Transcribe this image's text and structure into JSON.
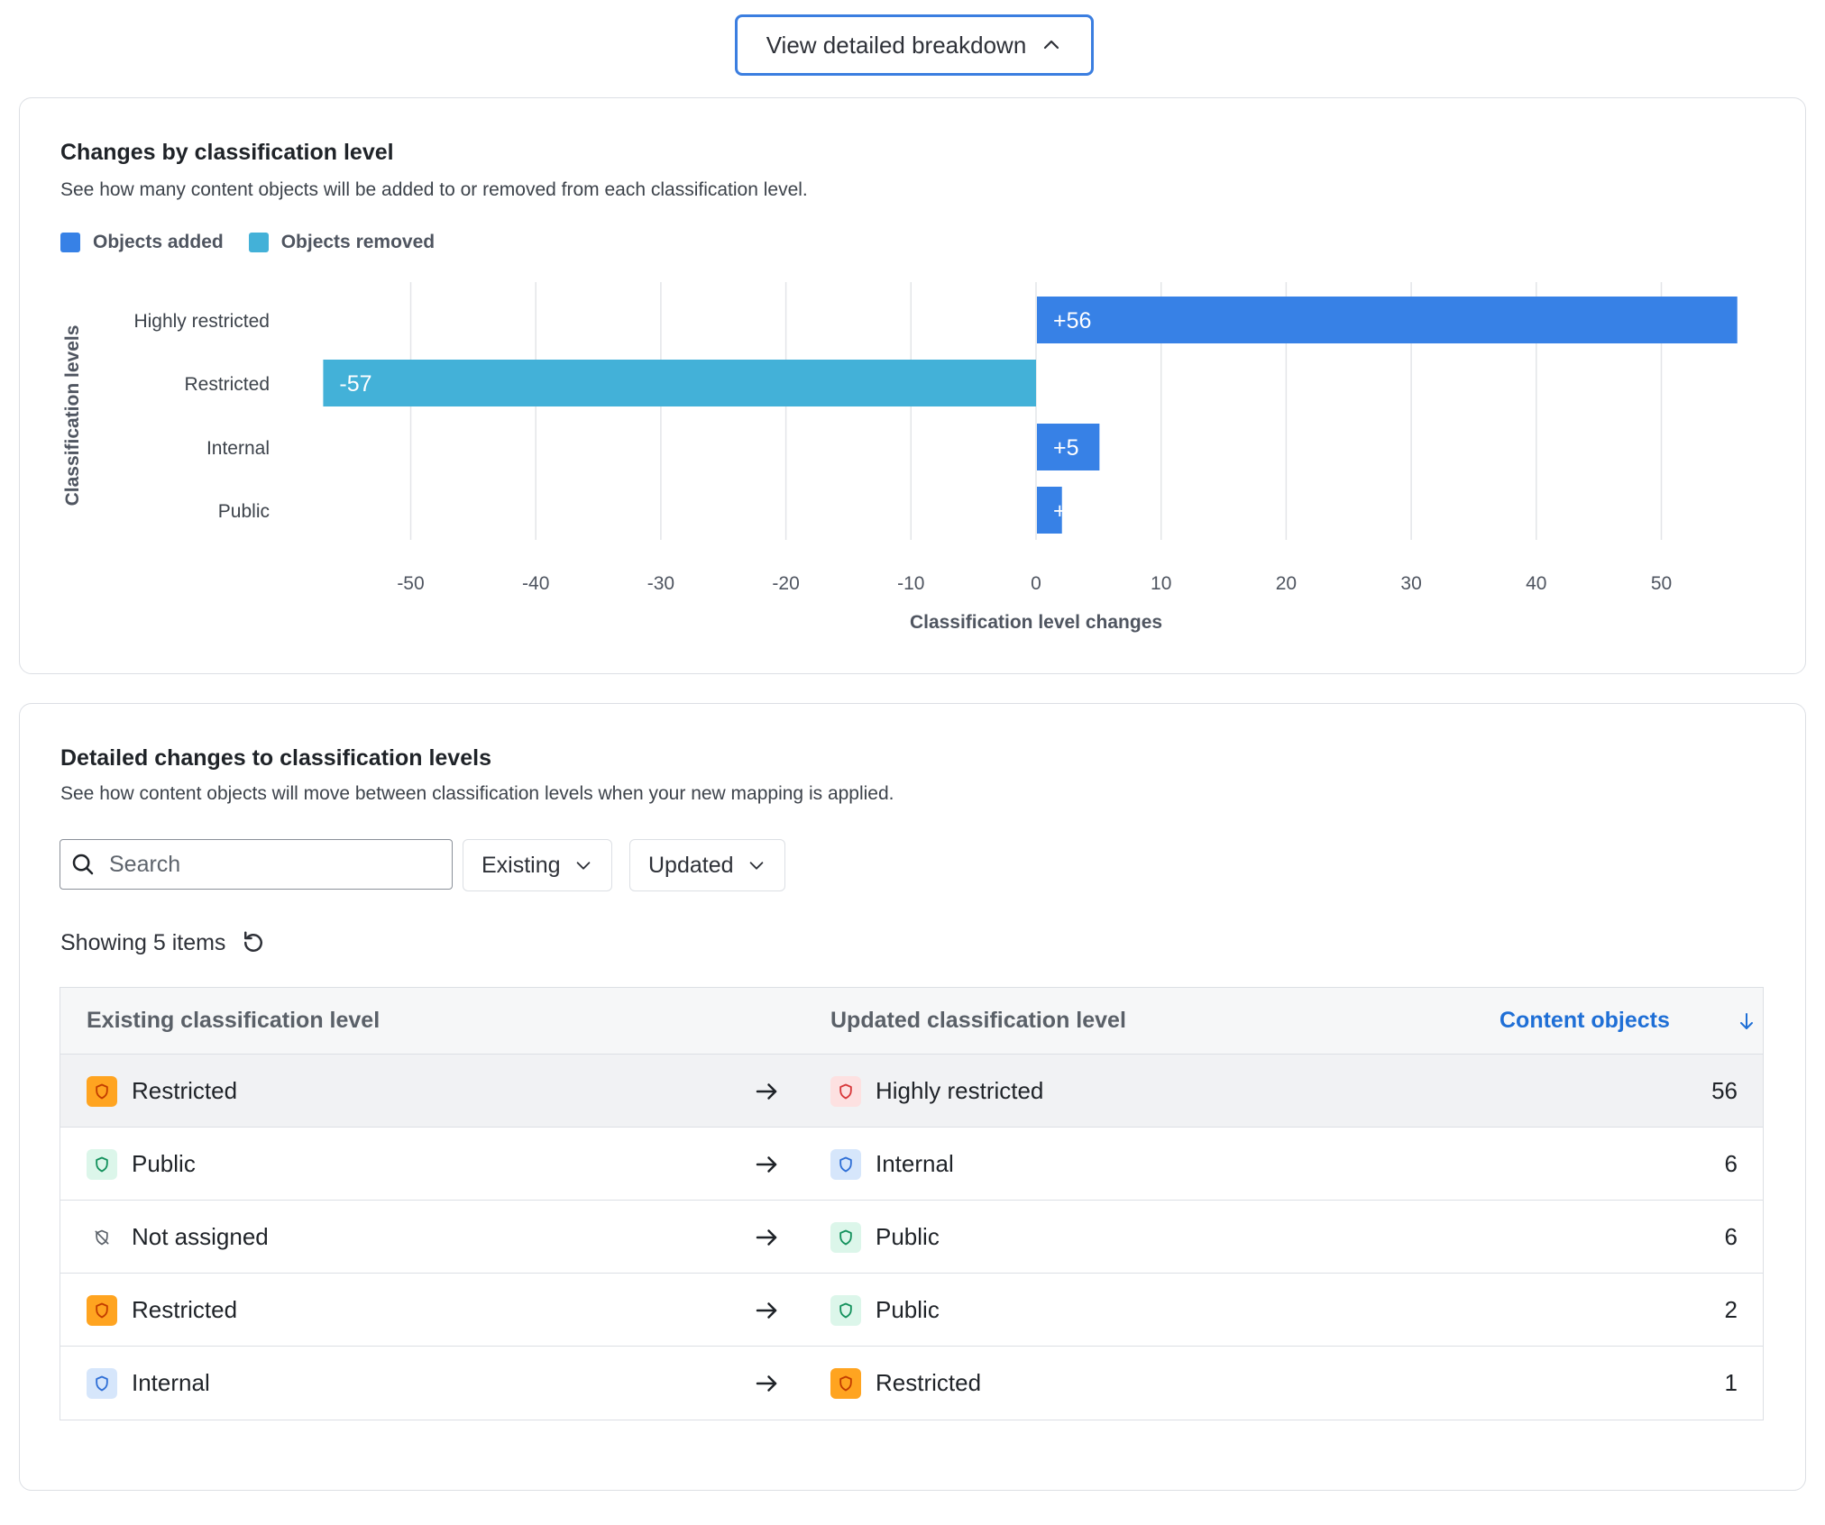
{
  "toggle": {
    "label": "View detailed breakdown",
    "icon": "chevron-up-icon"
  },
  "chart_card": {
    "title": "Changes by classification level",
    "subtitle": "See how many content objects will be added to or removed from each classification level.",
    "legend": [
      {
        "label": "Objects added",
        "color": "#3781e6"
      },
      {
        "label": "Objects removed",
        "color": "#43b1d8"
      }
    ]
  },
  "chart_data": {
    "type": "bar",
    "orientation": "horizontal",
    "categories": [
      "Highly restricted",
      "Restricted",
      "Internal",
      "Public"
    ],
    "values": [
      56,
      -57,
      5,
      2
    ],
    "data_labels": [
      "+56",
      "-57",
      "+5",
      "+"
    ],
    "series": [
      {
        "name": "Objects added",
        "color": "#3781e6"
      },
      {
        "name": "Objects removed",
        "color": "#43b1d8"
      }
    ],
    "xlabel": "Classification level changes",
    "ylabel": "Classification levels",
    "xlim": [
      -57,
      57
    ],
    "xticks": [
      -50,
      -40,
      -30,
      -20,
      -10,
      0,
      10,
      20,
      30,
      40,
      50
    ],
    "grid": "vertical",
    "legend": "top-left"
  },
  "table_card": {
    "title": "Detailed changes to classification levels",
    "subtitle": "See how content objects will move between classification levels when your new mapping is applied.",
    "search": {
      "placeholder": "Search",
      "value": ""
    },
    "filters": {
      "existing": "Existing",
      "updated": "Updated"
    },
    "showing": "Showing 5 items",
    "columns": {
      "existing": "Existing classification level",
      "updated": "Updated classification level",
      "content": "Content objects"
    },
    "rows": [
      {
        "existing": "Restricted",
        "existing_level": "restricted",
        "updated": "Highly restricted",
        "updated_level": "highly",
        "count": "56"
      },
      {
        "existing": "Public",
        "existing_level": "public",
        "updated": "Internal",
        "updated_level": "internal",
        "count": "6"
      },
      {
        "existing": "Not assigned",
        "existing_level": "none",
        "updated": "Public",
        "updated_level": "public",
        "count": "6"
      },
      {
        "existing": "Restricted",
        "existing_level": "restricted",
        "updated": "Public",
        "updated_level": "public",
        "count": "2"
      },
      {
        "existing": "Internal",
        "existing_level": "internal",
        "updated": "Restricted",
        "updated_level": "restricted",
        "count": "1"
      }
    ]
  },
  "level_styles": {
    "highly": {
      "bg": "#fde1e1",
      "fg": "#d8383a",
      "icon": "shield-icon"
    },
    "restricted": {
      "bg": "#ffa420",
      "fg": "#c23c00",
      "icon": "shield-icon"
    },
    "internal": {
      "bg": "#d6e6fb",
      "fg": "#2f6fd6",
      "icon": "shield-icon"
    },
    "public": {
      "bg": "#dcf6ea",
      "fg": "#13915c",
      "icon": "shield-icon"
    },
    "none": {
      "bg": "transparent",
      "fg": "#5a6068",
      "icon": "shield-off-icon"
    }
  }
}
